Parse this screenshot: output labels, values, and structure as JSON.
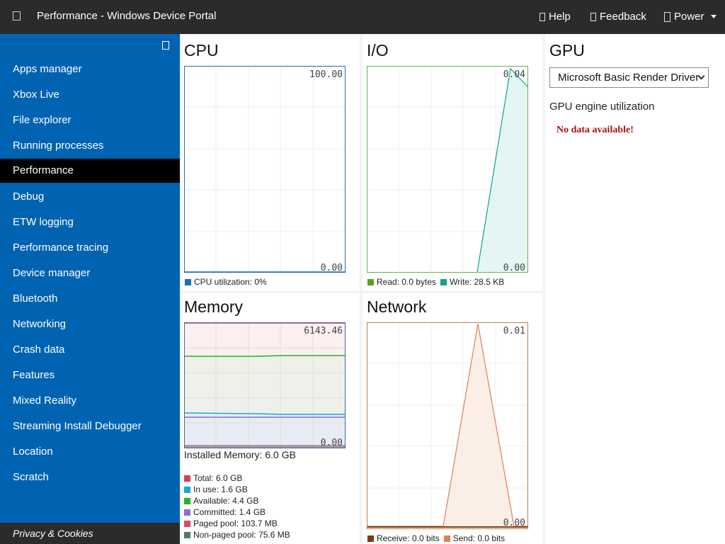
{
  "header": {
    "title": "Performance - Windows Device Portal",
    "help": "Help",
    "feedback": "Feedback",
    "power": "Power"
  },
  "sidebar": {
    "items": [
      {
        "label": "Apps manager"
      },
      {
        "label": "Xbox Live"
      },
      {
        "label": "File explorer"
      },
      {
        "label": "Running processes"
      },
      {
        "label": "Performance",
        "active": true
      },
      {
        "label": "Debug"
      },
      {
        "label": "ETW logging"
      },
      {
        "label": "Performance tracing"
      },
      {
        "label": "Device manager"
      },
      {
        "label": "Bluetooth"
      },
      {
        "label": "Networking"
      },
      {
        "label": "Crash data"
      },
      {
        "label": "Features"
      },
      {
        "label": "Mixed Reality"
      },
      {
        "label": "Streaming Install Debugger"
      },
      {
        "label": "Location"
      },
      {
        "label": "Scratch"
      }
    ],
    "footer": "Privacy & Cookies"
  },
  "cpu": {
    "title": "CPU",
    "max_label": "100.00",
    "min_label": "0.00",
    "legend": "CPU utilization: 0%",
    "color": "#1f6fb0",
    "utilization_percent": 0
  },
  "io": {
    "title": "I/O",
    "max_label": "0.04",
    "min_label": "0.00",
    "read_legend": "Read: 0.0 bytes",
    "write_legend": "Write: 28.5 KB",
    "read_color": "#5c9e1f",
    "write_color": "#14a08f",
    "border_color": "#6ab04c"
  },
  "memory": {
    "title": "Memory",
    "max_label": "6143.46",
    "min_label": "0.00",
    "installed": "Installed Memory: 6.0 GB",
    "border_color": "#3a6ea5",
    "items": [
      {
        "label": "Total: 6.0 GB",
        "color": "#d6404f"
      },
      {
        "label": "In use: 1.6 GB",
        "color": "#19a9d8"
      },
      {
        "label": "Available: 4.4 GB",
        "color": "#2bb02b"
      },
      {
        "label": "Committed: 1.4 GB",
        "color": "#8a6fd1"
      },
      {
        "label": "Paged pool: 103.7 MB",
        "color": "#d44a7a"
      },
      {
        "label": "Non-paged pool: 75.6 MB",
        "color": "#4e7a6b"
      }
    ]
  },
  "network": {
    "title": "Network",
    "max_label": "0.01",
    "min_label": "0.00",
    "receive_legend": "Receive: 0.0 bits",
    "send_legend": "Send: 0.0 bits",
    "receive_color": "#7a3b10",
    "send_color": "#d9825a",
    "border_color": "#c87941"
  },
  "gpu": {
    "title": "GPU",
    "selected": "Microsoft Basic Render Driver",
    "subtitle": "GPU engine utilization",
    "no_data": "No data available!"
  }
}
